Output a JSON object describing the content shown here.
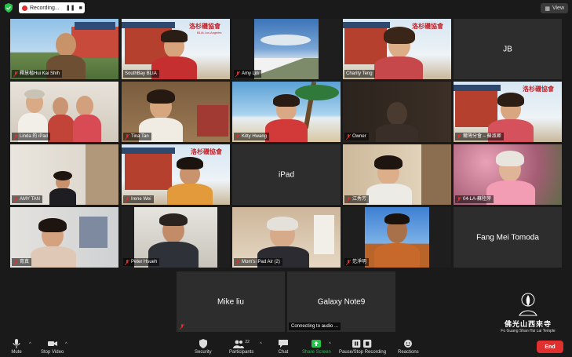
{
  "recording": {
    "label": "Recording..."
  },
  "view": {
    "label": "View"
  },
  "tiles": [
    {
      "name": "釋慧楷Hui Kai Shih"
    },
    {
      "name": "SouthBay BLIA"
    },
    {
      "name": "Amy Lin"
    },
    {
      "name": "Charity Teng"
    },
    {
      "name": "JB"
    },
    {
      "name": "Linda 的 iPad"
    },
    {
      "name": "Tina Tan"
    },
    {
      "name": "Kitty Hwang"
    },
    {
      "name": "Owner"
    },
    {
      "name": "爾灣分會 – 蘇淑卿"
    },
    {
      "name": "AMY TAN"
    },
    {
      "name": "Irene Wei"
    },
    {
      "name": "iPad"
    },
    {
      "name": "江秀芳"
    },
    {
      "name": "04-LA-蘇陸萍"
    },
    {
      "name": "育真"
    },
    {
      "name": "Peter Hsueh"
    },
    {
      "name": "Mom's iPad Air (2)"
    },
    {
      "name": "范淨明"
    },
    {
      "name": "Fang Mei Tomoda"
    },
    {
      "name": "Mike liu"
    },
    {
      "name": "Galaxy Note9",
      "status": "Connecting to audio ..."
    }
  ],
  "banner": {
    "org_cn": "洛杉磯協會",
    "org_en": "BLIA Los Angeles"
  },
  "watermark": {
    "cn": "佛光山西來寺",
    "en": "Fo Guang Shan Hsi Lai Temple"
  },
  "toolbar": {
    "mute": "Mute",
    "stop_video": "Stop Video",
    "security": "Security",
    "participants": "Participants",
    "participants_count": "22",
    "chat": "Chat",
    "share_screen": "Share Screen",
    "recording": "Pause/Stop Recording",
    "reactions": "Reactions",
    "end": "End"
  },
  "colors": {
    "active_border": "#f3e52f",
    "end_red": "#e02f2f",
    "share_green": "#27c24c",
    "tile_bg": "#2d2d2d"
  }
}
